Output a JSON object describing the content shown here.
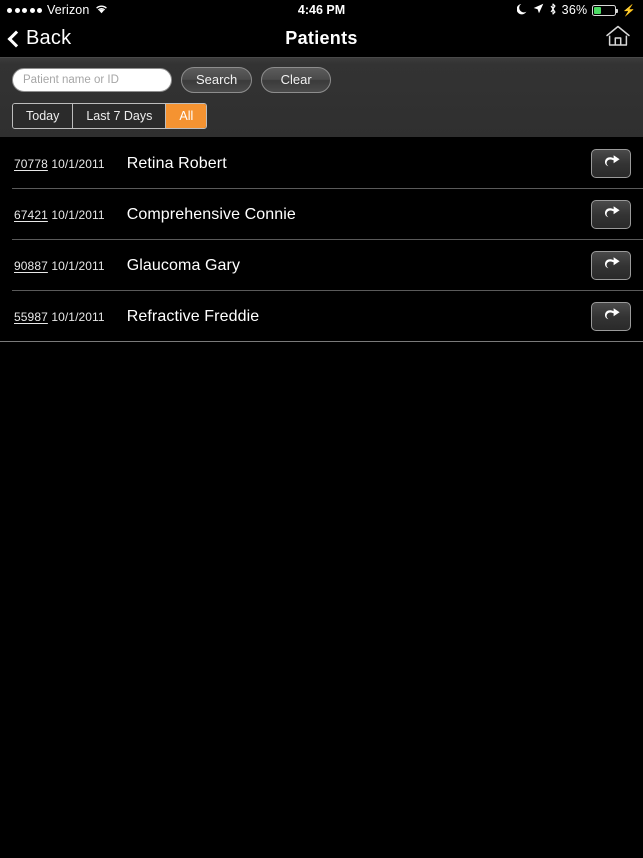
{
  "status_bar": {
    "signal_dots": 5,
    "carrier": "Verizon",
    "wifi_icon": "wifi-icon",
    "time": "4:46 PM",
    "moon_icon": "moon-icon",
    "location_icon": "location-arrow-icon",
    "bluetooth_icon": "bluetooth-icon",
    "battery_percent": "36%",
    "battery_level": 36,
    "battery_color": "#4cd964",
    "charging_icon": "lightning-bolt-icon"
  },
  "nav_bar": {
    "back_label": "Back",
    "back_icon": "chevron-left-icon",
    "title": "Patients",
    "home_icon": "home-icon"
  },
  "toolbar": {
    "search": {
      "placeholder": "Patient name or ID",
      "value": ""
    },
    "search_button_label": "Search",
    "clear_button_label": "Clear",
    "filters": [
      {
        "label": "Today",
        "active": false
      },
      {
        "label": "Last 7 Days",
        "active": false
      },
      {
        "label": "All",
        "active": true
      }
    ],
    "accent_color": "#f59331"
  },
  "patient_list": {
    "row_action_icon": "curved-arrow-right-icon",
    "rows": [
      {
        "patient_id": "70778",
        "date": "10/1/2011",
        "name": "Retina Robert"
      },
      {
        "patient_id": "67421",
        "date": "10/1/2011",
        "name": "Comprehensive Connie"
      },
      {
        "patient_id": "90887",
        "date": "10/1/2011",
        "name": "Glaucoma Gary"
      },
      {
        "patient_id": "55987",
        "date": "10/1/2011",
        "name": "Refractive Freddie"
      }
    ]
  }
}
